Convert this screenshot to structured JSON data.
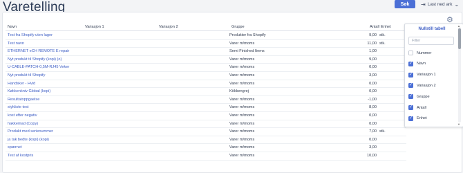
{
  "header": {
    "title": "Varetelling",
    "search_label": "Søk",
    "download_label": "Last ned ark"
  },
  "table": {
    "columns": [
      "Navn",
      "Variasjon 1",
      "Variasjon 2",
      "Gruppe",
      "Antall",
      "Enhet"
    ],
    "rows": [
      {
        "name": "Test fra Shopify uten lager",
        "group": "Produkter fra Shopify",
        "qty": "9,00",
        "unit": "stk."
      },
      {
        "name": "Test navn",
        "group": "Varer m/moms",
        "qty": "11,00",
        "unit": "stk."
      },
      {
        "name": "ETHERNET eCH REMOTE E repair",
        "group": "Semi Finished Items",
        "qty": "1,00",
        "unit": ""
      },
      {
        "name": "Nyt produkt til Shopify (kopi) (o)",
        "group": "Varer m/moms",
        "qty": "9,00",
        "unit": ""
      },
      {
        "name": "U-CABLE-PATCH-0,5M-RJ45 Veker",
        "group": "Varer m/moms",
        "qty": "0,00",
        "unit": ""
      },
      {
        "name": "Nyt produkt til Shopify",
        "group": "Varer m/moms",
        "qty": "3,00",
        "unit": ""
      },
      {
        "name": "Handsker - Hvid",
        "group": "Varer m/moms",
        "qty": "0,00",
        "unit": ""
      },
      {
        "name": "Køkkenkniv Global (kopi)",
        "group": "Kökkengrej",
        "qty": "0,00",
        "unit": ""
      },
      {
        "name": "Resultatoppgaelse",
        "group": "Varer m/moms",
        "qty": "-1,00",
        "unit": ""
      },
      {
        "name": "stykliste test",
        "group": "Varer m/moms",
        "qty": "8,00",
        "unit": ""
      },
      {
        "name": "kost efter negativ",
        "group": "Varer m/moms",
        "qty": "0,00",
        "unit": ""
      },
      {
        "name": "hakkemad (Copy)",
        "group": "Varer m/moms",
        "qty": "0,00",
        "unit": ""
      },
      {
        "name": "Produkt med serienummer",
        "group": "Varer m/moms",
        "qty": "7,00",
        "unit": "stk."
      },
      {
        "name": "ja tak bedte (kopi) (kopi)",
        "group": "Varer m/moms",
        "qty": "0,00",
        "unit": ""
      },
      {
        "name": "spærnet",
        "group": "Varer m/moms",
        "qty": "3,00",
        "unit": ""
      },
      {
        "name": "Test af kostpris",
        "group": "Varer m/moms",
        "qty": "10,00",
        "unit": ""
      }
    ]
  },
  "column_panel": {
    "reset_label": "Nullstill tabell",
    "filter_placeholder": "Filter",
    "options": [
      {
        "label": "Nummer",
        "checked": false
      },
      {
        "label": "Navn",
        "checked": true
      },
      {
        "label": "Variasjon 1",
        "checked": true
      },
      {
        "label": "Variasjon 2",
        "checked": true
      },
      {
        "label": "Gruppe",
        "checked": true
      },
      {
        "label": "Antall",
        "checked": true
      },
      {
        "label": "Enhet",
        "checked": true
      }
    ]
  },
  "colors": {
    "accent": "#4b6fd6",
    "link": "#3b5cc4"
  }
}
